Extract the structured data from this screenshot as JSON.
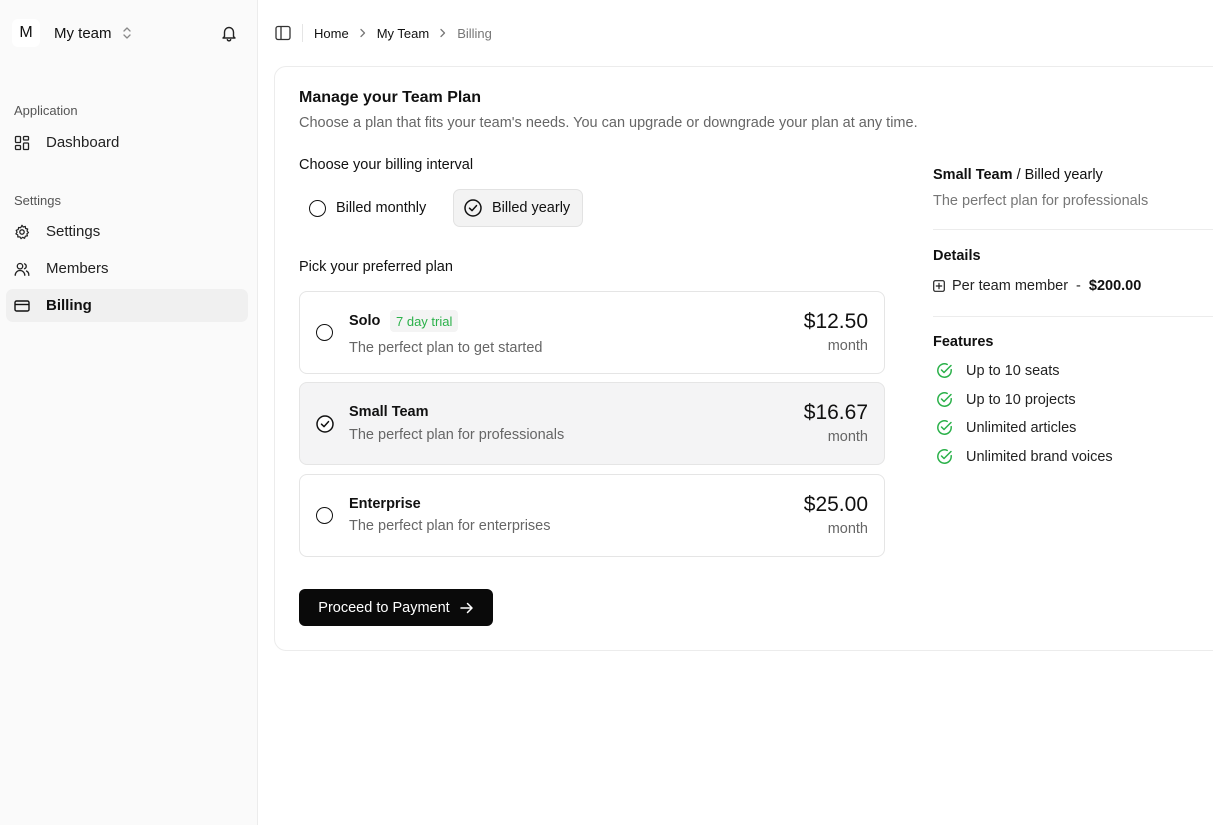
{
  "team": {
    "avatar_letter": "M",
    "name": "My team"
  },
  "sidebar": {
    "groups": [
      {
        "label": "Application"
      },
      {
        "label": "Settings"
      }
    ],
    "items": [
      {
        "label": "Dashboard",
        "icon": "dashboard-icon"
      },
      {
        "label": "Settings",
        "icon": "gear-icon"
      },
      {
        "label": "Members",
        "icon": "users-icon"
      },
      {
        "label": "Billing",
        "icon": "credit-card-icon",
        "active": true
      }
    ]
  },
  "breadcrumb": [
    "Home",
    "My Team",
    "Billing"
  ],
  "page": {
    "title": "Manage your Team Plan",
    "subtitle": "Choose a plan that fits your team's needs. You can upgrade or downgrade your plan at any time."
  },
  "billing_interval": {
    "label": "Choose your billing interval",
    "options": [
      {
        "label": "Billed monthly",
        "selected": false
      },
      {
        "label": "Billed yearly",
        "selected": true
      }
    ]
  },
  "plans": {
    "label": "Pick your preferred plan",
    "items": [
      {
        "name": "Solo",
        "badge": "7 day trial",
        "description": "The perfect plan to get started",
        "price": "$12.50",
        "period": "month",
        "selected": false
      },
      {
        "name": "Small Team",
        "description": "The perfect plan for professionals",
        "price": "$16.67",
        "period": "month",
        "selected": true
      },
      {
        "name": "Enterprise",
        "description": "The perfect plan for enterprises",
        "price": "$25.00",
        "period": "month",
        "selected": false
      }
    ]
  },
  "proceed_label": "Proceed to Payment",
  "summary": {
    "plan_name": "Small Team",
    "interval": "/ Billed yearly",
    "description": "The perfect plan for professionals",
    "details_heading": "Details",
    "detail_label": "Per team member",
    "detail_sep": "-",
    "detail_amount": "$200.00",
    "features_heading": "Features",
    "features": [
      "Up to 10 seats",
      "Up to 10 projects",
      "Unlimited articles",
      "Unlimited brand voices"
    ]
  },
  "colors": {
    "accent_green": "#2bb14a",
    "primary_button": "#0a0a0a"
  }
}
